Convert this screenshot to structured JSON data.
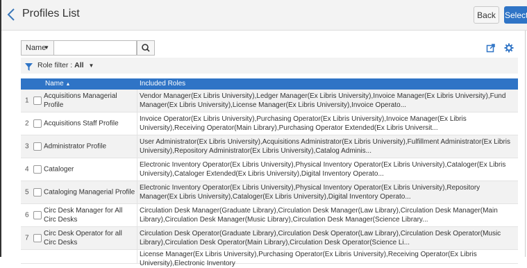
{
  "header": {
    "title": "Profiles List",
    "back_label": "Back",
    "select_label": "Select"
  },
  "search": {
    "field_label": "Name",
    "placeholder": "",
    "value": ""
  },
  "filter": {
    "label": "Role filter :",
    "value": "All"
  },
  "table": {
    "col_name": "Name",
    "col_roles": "Included Roles",
    "rows": [
      {
        "num": "1",
        "name": "Acquisitions Managerial Profile",
        "roles": "Vendor Manager(Ex Libris University),Ledger Manager(Ex Libris University),Invoice Manager(Ex Libris University),Fund Manager(Ex Libris University),License Manager(Ex Libris University),Invoice Operato..."
      },
      {
        "num": "2",
        "name": "Acquisitions Staff Profile",
        "roles": "Invoice Operator(Ex Libris University),Purchasing Operator(Ex Libris University),Invoice Manager(Ex Libris University),Receiving Operator(Main Library),Purchasing Operator Extended(Ex Libris Universit..."
      },
      {
        "num": "3",
        "name": "Administrator Profile",
        "roles": "User Administrator(Ex Libris University),Acquisitions Administrator(Ex Libris University),Fulfillment Administrator(Ex Libris University),Repository Administrator(Ex Libris University),Catalog Adminis..."
      },
      {
        "num": "4",
        "name": "Cataloger",
        "roles": "Electronic Inventory Operator(Ex Libris University),Physical Inventory Operator(Ex Libris University),Cataloger(Ex Libris University),Cataloger Extended(Ex Libris University),Digital Inventory Operato..."
      },
      {
        "num": "5",
        "name": "Cataloging Managerial Profile",
        "roles": "Electronic Inventory Operator(Ex Libris University),Physical Inventory Operator(Ex Libris University),Repository Manager(Ex Libris University),Cataloger(Ex Libris University),Digital Inventory Operato..."
      },
      {
        "num": "6",
        "name": "Circ Desk Manager for All Circ Desks",
        "roles": "Circulation Desk Manager(Graduate Library),Circulation Desk Manager(Law Library),Circulation Desk Manager(Main Library),Circulation Desk Manager(Music Library),Circulation Desk Manager(Science Library..."
      },
      {
        "num": "7",
        "name": "Circ Desk Operator for all Circ Desks",
        "roles": "Circulation Desk Operator(Graduate Library),Circulation Desk Operator(Law Library),Circulation Desk Operator(Music Library),Circulation Desk Operator(Main Library),Circulation Desk Operator(Science Li..."
      },
      {
        "num": "",
        "name": "",
        "roles": "License Manager(Ex Libris University),Purchasing Operator(Ex Libris University),Receiving Operator(Ex Libris University),Electronic Inventory"
      }
    ]
  },
  "colors": {
    "accent": "#2f74c6",
    "header_bg": "#f3f3f3"
  },
  "icons": {
    "back": "chevron-left-icon",
    "search": "search-icon",
    "export": "export-icon",
    "settings": "gear-icon",
    "filter": "filter-icon",
    "sort": "sort-asc-icon"
  }
}
